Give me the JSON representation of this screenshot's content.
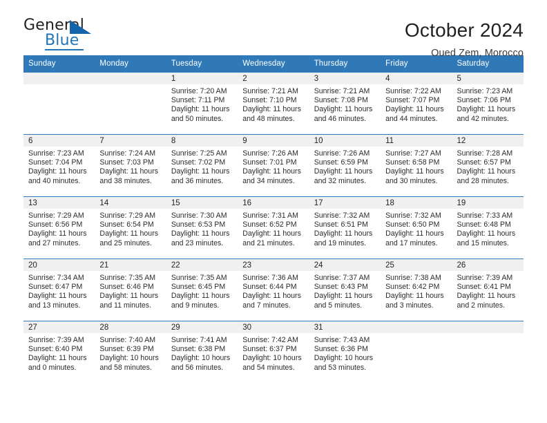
{
  "brand": {
    "name_top": "General",
    "name_bottom": "Blue",
    "accent_color": "#1f74bb",
    "triangle_color": "#1464ab"
  },
  "header": {
    "title": "October 2024",
    "subtitle": "Oued Zem, Morocco"
  },
  "calendar": {
    "header_bg": "#3079b8",
    "daynum_band_bg": "#f0f0f0",
    "weekday_headers": [
      "Sunday",
      "Monday",
      "Tuesday",
      "Wednesday",
      "Thursday",
      "Friday",
      "Saturday"
    ],
    "weeks": [
      [
        {
          "day": "",
          "sunrise": "",
          "sunset": "",
          "daylight_line1": "",
          "daylight_line2": ""
        },
        {
          "day": "",
          "sunrise": "",
          "sunset": "",
          "daylight_line1": "",
          "daylight_line2": ""
        },
        {
          "day": "1",
          "sunrise": "Sunrise: 7:20 AM",
          "sunset": "Sunset: 7:11 PM",
          "daylight_line1": "Daylight: 11 hours",
          "daylight_line2": "and 50 minutes."
        },
        {
          "day": "2",
          "sunrise": "Sunrise: 7:21 AM",
          "sunset": "Sunset: 7:10 PM",
          "daylight_line1": "Daylight: 11 hours",
          "daylight_line2": "and 48 minutes."
        },
        {
          "day": "3",
          "sunrise": "Sunrise: 7:21 AM",
          "sunset": "Sunset: 7:08 PM",
          "daylight_line1": "Daylight: 11 hours",
          "daylight_line2": "and 46 minutes."
        },
        {
          "day": "4",
          "sunrise": "Sunrise: 7:22 AM",
          "sunset": "Sunset: 7:07 PM",
          "daylight_line1": "Daylight: 11 hours",
          "daylight_line2": "and 44 minutes."
        },
        {
          "day": "5",
          "sunrise": "Sunrise: 7:23 AM",
          "sunset": "Sunset: 7:06 PM",
          "daylight_line1": "Daylight: 11 hours",
          "daylight_line2": "and 42 minutes."
        }
      ],
      [
        {
          "day": "6",
          "sunrise": "Sunrise: 7:23 AM",
          "sunset": "Sunset: 7:04 PM",
          "daylight_line1": "Daylight: 11 hours",
          "daylight_line2": "and 40 minutes."
        },
        {
          "day": "7",
          "sunrise": "Sunrise: 7:24 AM",
          "sunset": "Sunset: 7:03 PM",
          "daylight_line1": "Daylight: 11 hours",
          "daylight_line2": "and 38 minutes."
        },
        {
          "day": "8",
          "sunrise": "Sunrise: 7:25 AM",
          "sunset": "Sunset: 7:02 PM",
          "daylight_line1": "Daylight: 11 hours",
          "daylight_line2": "and 36 minutes."
        },
        {
          "day": "9",
          "sunrise": "Sunrise: 7:26 AM",
          "sunset": "Sunset: 7:01 PM",
          "daylight_line1": "Daylight: 11 hours",
          "daylight_line2": "and 34 minutes."
        },
        {
          "day": "10",
          "sunrise": "Sunrise: 7:26 AM",
          "sunset": "Sunset: 6:59 PM",
          "daylight_line1": "Daylight: 11 hours",
          "daylight_line2": "and 32 minutes."
        },
        {
          "day": "11",
          "sunrise": "Sunrise: 7:27 AM",
          "sunset": "Sunset: 6:58 PM",
          "daylight_line1": "Daylight: 11 hours",
          "daylight_line2": "and 30 minutes."
        },
        {
          "day": "12",
          "sunrise": "Sunrise: 7:28 AM",
          "sunset": "Sunset: 6:57 PM",
          "daylight_line1": "Daylight: 11 hours",
          "daylight_line2": "and 28 minutes."
        }
      ],
      [
        {
          "day": "13",
          "sunrise": "Sunrise: 7:29 AM",
          "sunset": "Sunset: 6:56 PM",
          "daylight_line1": "Daylight: 11 hours",
          "daylight_line2": "and 27 minutes."
        },
        {
          "day": "14",
          "sunrise": "Sunrise: 7:29 AM",
          "sunset": "Sunset: 6:54 PM",
          "daylight_line1": "Daylight: 11 hours",
          "daylight_line2": "and 25 minutes."
        },
        {
          "day": "15",
          "sunrise": "Sunrise: 7:30 AM",
          "sunset": "Sunset: 6:53 PM",
          "daylight_line1": "Daylight: 11 hours",
          "daylight_line2": "and 23 minutes."
        },
        {
          "day": "16",
          "sunrise": "Sunrise: 7:31 AM",
          "sunset": "Sunset: 6:52 PM",
          "daylight_line1": "Daylight: 11 hours",
          "daylight_line2": "and 21 minutes."
        },
        {
          "day": "17",
          "sunrise": "Sunrise: 7:32 AM",
          "sunset": "Sunset: 6:51 PM",
          "daylight_line1": "Daylight: 11 hours",
          "daylight_line2": "and 19 minutes."
        },
        {
          "day": "18",
          "sunrise": "Sunrise: 7:32 AM",
          "sunset": "Sunset: 6:50 PM",
          "daylight_line1": "Daylight: 11 hours",
          "daylight_line2": "and 17 minutes."
        },
        {
          "day": "19",
          "sunrise": "Sunrise: 7:33 AM",
          "sunset": "Sunset: 6:48 PM",
          "daylight_line1": "Daylight: 11 hours",
          "daylight_line2": "and 15 minutes."
        }
      ],
      [
        {
          "day": "20",
          "sunrise": "Sunrise: 7:34 AM",
          "sunset": "Sunset: 6:47 PM",
          "daylight_line1": "Daylight: 11 hours",
          "daylight_line2": "and 13 minutes."
        },
        {
          "day": "21",
          "sunrise": "Sunrise: 7:35 AM",
          "sunset": "Sunset: 6:46 PM",
          "daylight_line1": "Daylight: 11 hours",
          "daylight_line2": "and 11 minutes."
        },
        {
          "day": "22",
          "sunrise": "Sunrise: 7:35 AM",
          "sunset": "Sunset: 6:45 PM",
          "daylight_line1": "Daylight: 11 hours",
          "daylight_line2": "and 9 minutes."
        },
        {
          "day": "23",
          "sunrise": "Sunrise: 7:36 AM",
          "sunset": "Sunset: 6:44 PM",
          "daylight_line1": "Daylight: 11 hours",
          "daylight_line2": "and 7 minutes."
        },
        {
          "day": "24",
          "sunrise": "Sunrise: 7:37 AM",
          "sunset": "Sunset: 6:43 PM",
          "daylight_line1": "Daylight: 11 hours",
          "daylight_line2": "and 5 minutes."
        },
        {
          "day": "25",
          "sunrise": "Sunrise: 7:38 AM",
          "sunset": "Sunset: 6:42 PM",
          "daylight_line1": "Daylight: 11 hours",
          "daylight_line2": "and 3 minutes."
        },
        {
          "day": "26",
          "sunrise": "Sunrise: 7:39 AM",
          "sunset": "Sunset: 6:41 PM",
          "daylight_line1": "Daylight: 11 hours",
          "daylight_line2": "and 2 minutes."
        }
      ],
      [
        {
          "day": "27",
          "sunrise": "Sunrise: 7:39 AM",
          "sunset": "Sunset: 6:40 PM",
          "daylight_line1": "Daylight: 11 hours",
          "daylight_line2": "and 0 minutes."
        },
        {
          "day": "28",
          "sunrise": "Sunrise: 7:40 AM",
          "sunset": "Sunset: 6:39 PM",
          "daylight_line1": "Daylight: 10 hours",
          "daylight_line2": "and 58 minutes."
        },
        {
          "day": "29",
          "sunrise": "Sunrise: 7:41 AM",
          "sunset": "Sunset: 6:38 PM",
          "daylight_line1": "Daylight: 10 hours",
          "daylight_line2": "and 56 minutes."
        },
        {
          "day": "30",
          "sunrise": "Sunrise: 7:42 AM",
          "sunset": "Sunset: 6:37 PM",
          "daylight_line1": "Daylight: 10 hours",
          "daylight_line2": "and 54 minutes."
        },
        {
          "day": "31",
          "sunrise": "Sunrise: 7:43 AM",
          "sunset": "Sunset: 6:36 PM",
          "daylight_line1": "Daylight: 10 hours",
          "daylight_line2": "and 53 minutes."
        },
        {
          "day": "",
          "sunrise": "",
          "sunset": "",
          "daylight_line1": "",
          "daylight_line2": ""
        },
        {
          "day": "",
          "sunrise": "",
          "sunset": "",
          "daylight_line1": "",
          "daylight_line2": ""
        }
      ]
    ]
  }
}
